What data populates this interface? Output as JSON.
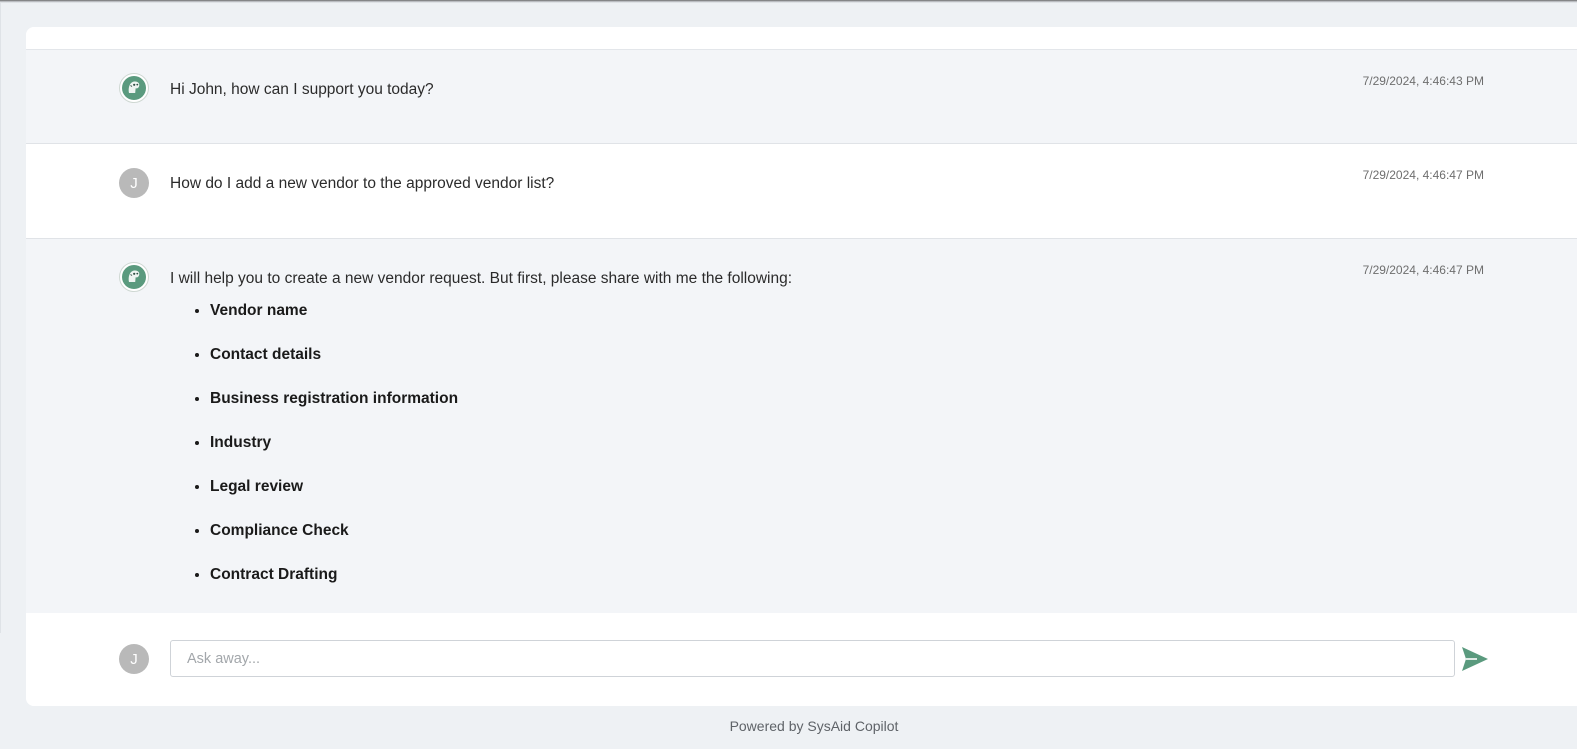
{
  "messages": [
    {
      "role": "bot",
      "text": "Hi John, how can I support you today?",
      "timestamp": "7/29/2024, 4:46:43 PM"
    },
    {
      "role": "user",
      "avatar_initial": "J",
      "text": "How do I add a new vendor to the approved vendor list?",
      "timestamp": "7/29/2024, 4:46:47 PM"
    },
    {
      "role": "bot",
      "text": "I will help you to create a new vendor request. But first, please share with me the following:",
      "timestamp": "7/29/2024, 4:46:47 PM",
      "list": [
        "Vendor name",
        "Contact details",
        "Business registration information",
        "Industry",
        "Legal review",
        "Compliance Check",
        "Contract Drafting"
      ]
    }
  ],
  "composer": {
    "avatar_initial": "J",
    "placeholder": "Ask away...",
    "value": "",
    "send_icon": "send-icon"
  },
  "footer": {
    "text": "Powered by SysAid Copilot"
  },
  "colors": {
    "accent": "#5a9a7e",
    "bot_bg": "#f3f5f8",
    "user_avatar": "#b9b9b9"
  }
}
